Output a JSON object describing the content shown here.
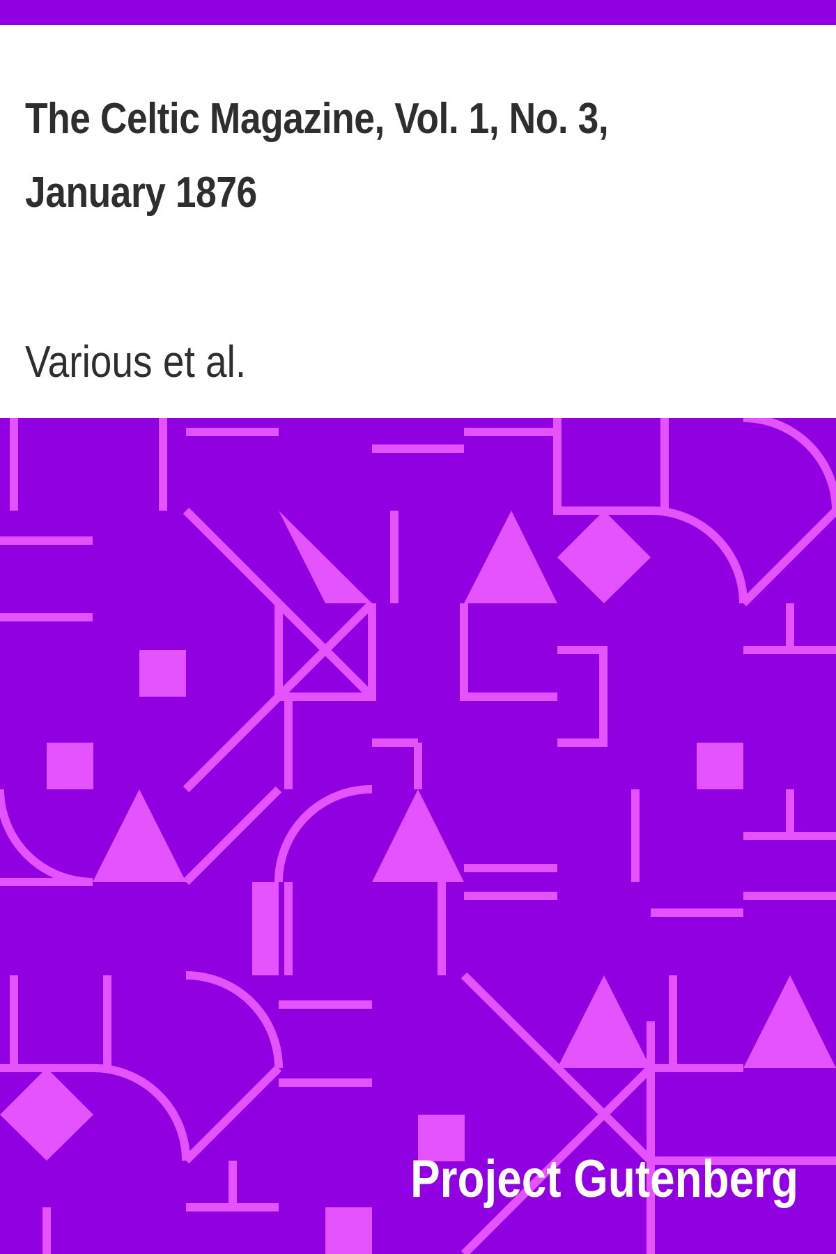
{
  "cover": {
    "title": "The Celtic Magazine, Vol. 1, No. 3, January 1876",
    "author": "Various et al.",
    "publisher": "Project Gutenberg"
  },
  "colors": {
    "background_purple": "#9000e0",
    "pattern_magenta": "#e552ff",
    "text_dark": "#2e2e2e",
    "header_white": "#ffffff"
  }
}
